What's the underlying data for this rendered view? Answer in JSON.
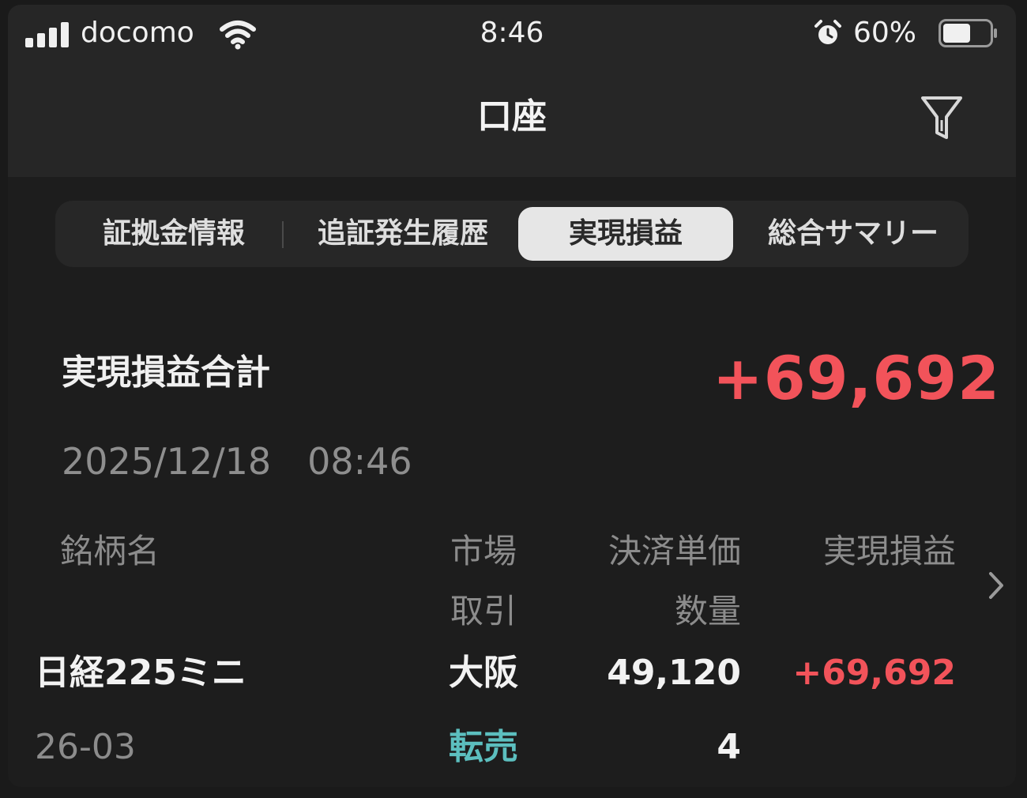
{
  "status_bar": {
    "carrier": "docomo",
    "time": "8:46",
    "battery_percent": "60%",
    "battery_level": 0.6,
    "icons": [
      "signal-icon",
      "wifi-icon",
      "alarm-icon",
      "battery-icon"
    ]
  },
  "nav": {
    "title": "口座",
    "filter_icon": "filter-icon"
  },
  "tabs": [
    {
      "label": "証拠金情報",
      "active": false
    },
    {
      "label": "追証発生履歴",
      "active": false
    },
    {
      "label": "実現損益",
      "active": true
    },
    {
      "label": "総合サマリー",
      "active": false
    }
  ],
  "summary": {
    "label": "実現損益合計",
    "value": "+69,692",
    "timestamp": "2025/12/18　08:46"
  },
  "table": {
    "headers": {
      "name": "銘柄名",
      "market": "市場",
      "trade": "取引",
      "settle_price": "決済単価",
      "quantity": "数量",
      "pnl": "実現損益"
    },
    "rows": [
      {
        "name": "日経225ミニ",
        "contract": "26-03",
        "market": "大阪",
        "trade": "転売",
        "settle_price": "49,120",
        "quantity": "4",
        "pnl": "+69,692"
      }
    ]
  },
  "colors": {
    "background": "#1d1d1d",
    "bar": "#262626",
    "profit": "#f2535a",
    "trade_type": "#5cbfbf",
    "muted": "#8c8c8c",
    "active_tab": "#e6e6e6"
  }
}
